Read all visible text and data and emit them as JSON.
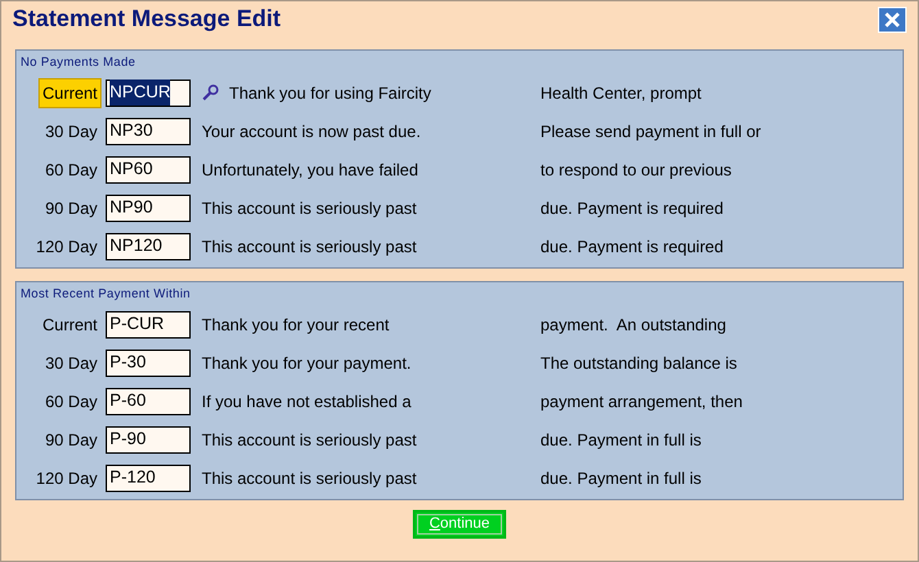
{
  "window": {
    "title": "Statement Message Edit"
  },
  "sections": [
    {
      "title": "No Payments Made",
      "rows": [
        {
          "label": "Current",
          "code": "NPCUR",
          "selected": true,
          "line_1": "Thank you for using Faircity",
          "line_2": "Health Center, prompt"
        },
        {
          "label": "30 Day",
          "code": "NP30",
          "selected": false,
          "line_1": "Your account is now past due.",
          "line_2": "Please send payment in full or"
        },
        {
          "label": "60 Day",
          "code": "NP60",
          "selected": false,
          "line_1": "Unfortunately, you have failed",
          "line_2": "to respond to our previous"
        },
        {
          "label": "90 Day",
          "code": "NP90",
          "selected": false,
          "line_1": "This account is seriously past",
          "line_2": "due. Payment is required"
        },
        {
          "label": "120 Day",
          "code": "NP120",
          "selected": false,
          "line_1": "This account is seriously past",
          "line_2": "due. Payment is required"
        }
      ]
    },
    {
      "title": "Most Recent Payment Within",
      "rows": [
        {
          "label": "Current",
          "code": "P-CUR",
          "selected": false,
          "line_1": "Thank you for your recent",
          "line_2": "payment.  An outstanding"
        },
        {
          "label": "30 Day",
          "code": "P-30",
          "selected": false,
          "line_1": "Thank you for your payment.",
          "line_2": "The outstanding balance is"
        },
        {
          "label": "60 Day",
          "code": "P-60",
          "selected": false,
          "line_1": "If you have not established a",
          "line_2": "payment arrangement, then"
        },
        {
          "label": "90 Day",
          "code": "P-90",
          "selected": false,
          "line_1": "This account is seriously past",
          "line_2": "due. Payment in full is"
        },
        {
          "label": "120 Day",
          "code": "P-120",
          "selected": false,
          "line_1": "This account is seriously past",
          "line_2": "due. Payment in full is"
        }
      ]
    }
  ],
  "buttons": [
    {
      "label": "Continue"
    }
  ]
}
